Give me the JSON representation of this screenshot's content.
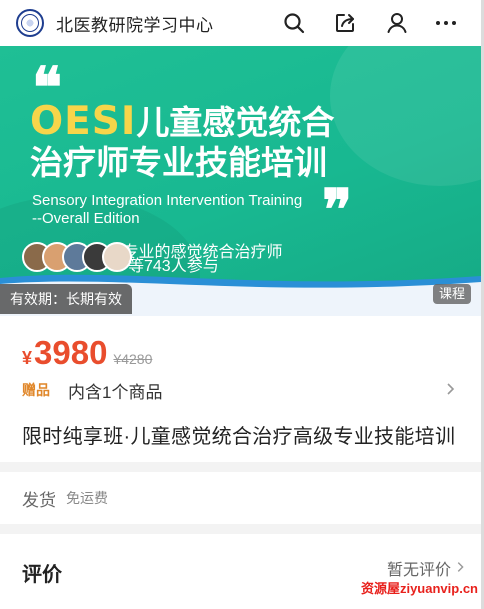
{
  "header": {
    "title": "北医教研院学习中心",
    "icons": [
      "search-icon",
      "share-icon",
      "user-icon",
      "more-icon"
    ],
    "brand_color": "#1e3d8f"
  },
  "banner": {
    "headline_accent": "OESI",
    "headline_rest": "儿童感觉统合",
    "headline_line2": "治疗师专业技能培训",
    "english_line1": "Sensory Integration Intervention Training",
    "english_line2": "--Overall Edition",
    "tagline": "训,成为专业的感觉统合治疗师",
    "participants": "等743人参与",
    "validity": "有效期：长期有效",
    "type_badge": "课程",
    "accent_color": "#f7d54a",
    "background_color": "#1fbf95"
  },
  "price": {
    "currency": "¥",
    "current": "3980",
    "original": "¥4280",
    "color": "#e94d2d"
  },
  "gift": {
    "tag": "赠品",
    "text": "内含1个商品"
  },
  "product": {
    "title": "限时纯享班·儿童感觉统合治疗高级专业技能培训"
  },
  "shipping": {
    "label": "发货",
    "value": "免运费"
  },
  "reviews": {
    "title": "评价",
    "link": "暂无评价"
  },
  "watermark": "资源屋ziyuanvip.cn"
}
